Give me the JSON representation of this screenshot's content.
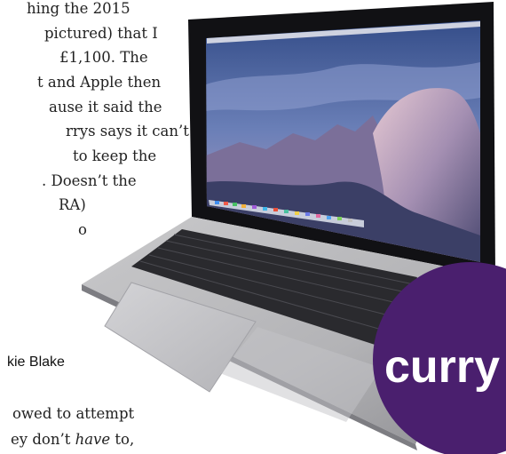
{
  "article": {
    "lines": [
      "hing the 2015",
      "pictured) that I",
      "£1,100. The",
      "t and Apple then",
      "ause it said the",
      "rrys says it can’t",
      "to keep the",
      ". Doesn’t the",
      "RA)",
      "o"
    ],
    "byline": "kie Blake",
    "line_bottom_1": "owed to attempt",
    "line_bottom_2_pre": "ey don’t ",
    "line_bottom_2_em": "have",
    "line_bottom_2_post": " to,"
  },
  "logo": {
    "text": "curry",
    "color": "#4a1f6e"
  },
  "laptop": {
    "screen_icon_names": [
      "menubar",
      "dock"
    ]
  }
}
